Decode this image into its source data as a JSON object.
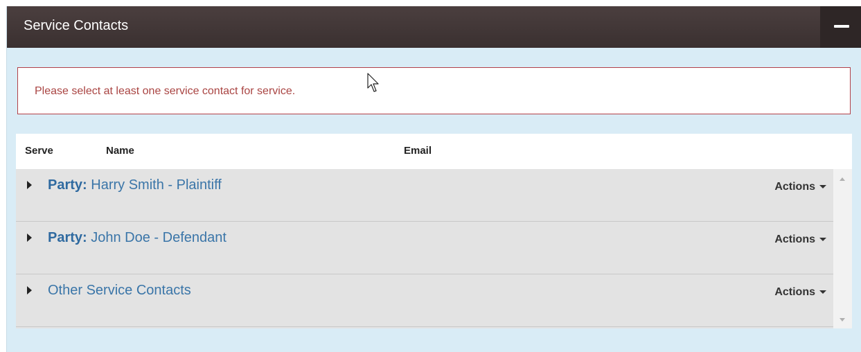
{
  "panel": {
    "title": "Service Contacts",
    "collapse_icon": "minus-icon"
  },
  "alert": {
    "message": "Please select at least one service contact for service."
  },
  "table": {
    "columns": [
      "Serve",
      "Name",
      "Email"
    ],
    "rows": [
      {
        "prefix": "Party:",
        "label": " Harry Smith - Plaintiff",
        "actions": "Actions"
      },
      {
        "prefix": "Party:",
        "label": " John Doe - Defendant",
        "actions": "Actions"
      },
      {
        "prefix": "",
        "label": "Other Service Contacts",
        "actions": "Actions"
      }
    ]
  },
  "colors": {
    "header_bg": "#3d3232",
    "panel_bg": "#d9ecf6",
    "alert_border": "#b24048",
    "alert_text": "#a94442",
    "link": "#3a75a8"
  }
}
